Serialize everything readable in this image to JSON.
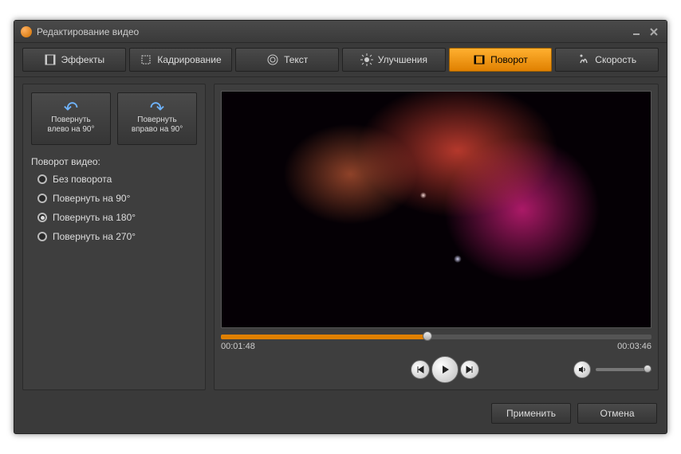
{
  "window": {
    "title": "Редактирование видео"
  },
  "tabs": [
    {
      "label": "Эффекты",
      "active": false
    },
    {
      "label": "Кадрирование",
      "active": false
    },
    {
      "label": "Текст",
      "active": false
    },
    {
      "label": "Улучшения",
      "active": false
    },
    {
      "label": "Поворот",
      "active": true
    },
    {
      "label": "Скорость",
      "active": false
    }
  ],
  "rotate_buttons": {
    "left": {
      "line1": "Повернуть",
      "line2": "влево  на 90°"
    },
    "right": {
      "line1": "Повернуть",
      "line2": "вправо на 90°"
    }
  },
  "rotation": {
    "section_label": "Поворот видео:",
    "options": [
      {
        "label": "Без поворота",
        "selected": false
      },
      {
        "label": "Повернуть на 90°",
        "selected": false
      },
      {
        "label": "Повернуть на 180°",
        "selected": true
      },
      {
        "label": "Повернуть на 270°",
        "selected": false
      }
    ]
  },
  "player": {
    "current_time": "00:01:48",
    "total_time": "00:03:46",
    "progress_percent": 48
  },
  "footer": {
    "apply": "Применить",
    "cancel": "Отмена"
  },
  "colors": {
    "accent": "#e08000"
  }
}
